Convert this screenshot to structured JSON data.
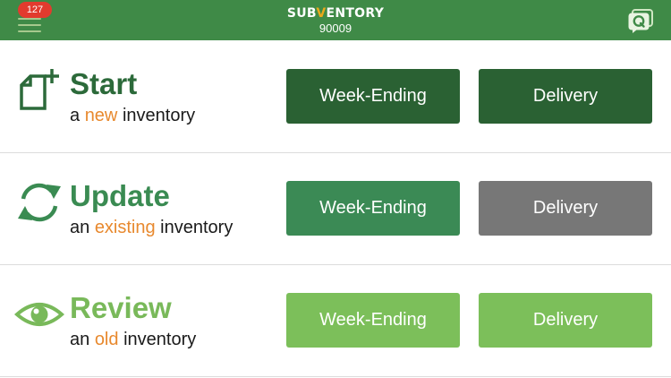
{
  "header": {
    "notification_count": "127",
    "logo": {
      "part1": "SUB",
      "check": "V",
      "part2": "ENTORY"
    },
    "store_number": "90009",
    "quick_icon": "q-chat-icon",
    "menu_icon": "hamburger-icon"
  },
  "rows": [
    {
      "title": "Start",
      "sub_prefix": "a ",
      "sub_highlight": "new",
      "sub_suffix": " inventory",
      "icon": "new-document-icon",
      "buttons": {
        "left": "Week-Ending",
        "right": "Delivery"
      }
    },
    {
      "title": "Update",
      "sub_prefix": "an ",
      "sub_highlight": "existing",
      "sub_suffix": " inventory",
      "icon": "refresh-icon",
      "buttons": {
        "left": "Week-Ending",
        "right": "Delivery"
      }
    },
    {
      "title": "Review",
      "sub_prefix": "an ",
      "sub_highlight": "old",
      "sub_suffix": " inventory",
      "icon": "eye-icon",
      "buttons": {
        "left": "Week-Ending",
        "right": "Delivery"
      }
    }
  ],
  "colors": {
    "header": "#3f8a47",
    "accent_orange": "#e8892e",
    "start_green": "#2a6133",
    "update_green": "#3b8a55",
    "review_green": "#7cbf5a",
    "disabled_gray": "#777777",
    "badge_red": "#e23b2e"
  }
}
